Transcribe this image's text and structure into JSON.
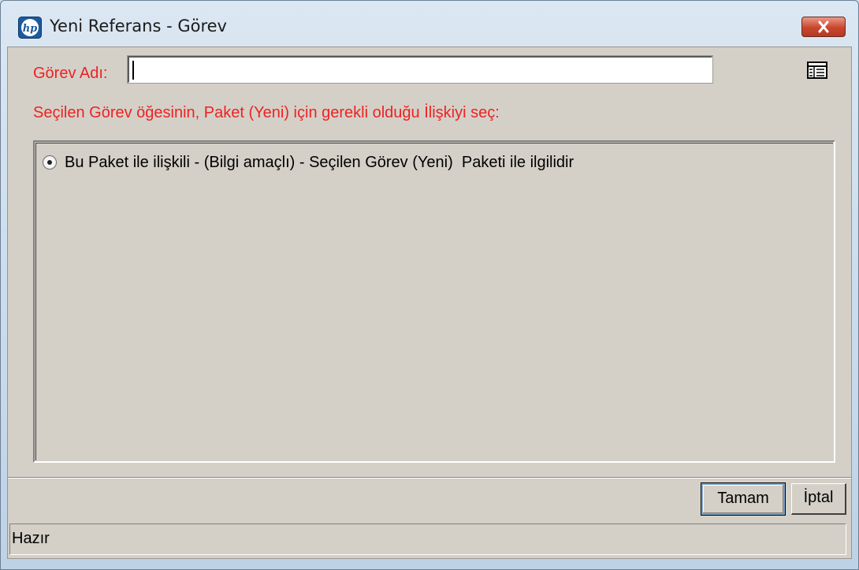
{
  "window": {
    "title": "Yeni Referans - Görev",
    "app_icon": "hp-logo-icon",
    "close_icon": "close-icon",
    "close_color": "#c9462e"
  },
  "form": {
    "task_label": "Görev Adı:",
    "task_value": "",
    "lookup_icon": "list-lookup-icon",
    "instruction": "Seçilen Görev öğesinin, Paket (Yeni) için gerekli olduğu İlişkiyi seç:",
    "label_color": "#ee2222"
  },
  "options": [
    {
      "label": "Bu Paket ile ilişkili - (Bilgi amaçlı) - Seçilen Görev (Yeni)  Paketi ile ilgilidir",
      "selected": true
    }
  ],
  "buttons": {
    "ok": "Tamam",
    "cancel": "İptal"
  },
  "status": {
    "text": "Hazır"
  }
}
